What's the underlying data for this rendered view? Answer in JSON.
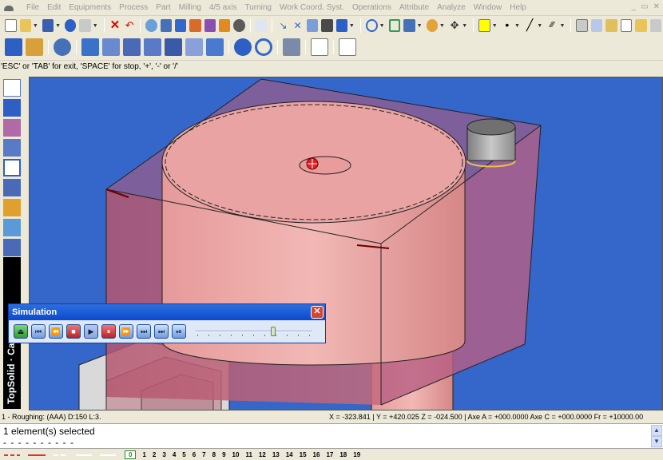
{
  "menu": {
    "items": [
      "File",
      "Edit",
      "Equipments",
      "Process",
      "Part",
      "Milling",
      "4/5 axis",
      "Turning",
      "Work Coord. Syst.",
      "Operations",
      "Attribute",
      "Analyze",
      "Window",
      "Help"
    ]
  },
  "prompt": "'ESC' or 'TAB' for exit, 'SPACE' for stop, '+', '-' or '/'",
  "simulation": {
    "title": "Simulation",
    "slider_fraction": 0.66
  },
  "brand": {
    "text": "TopSolid · Ca"
  },
  "status": {
    "left": "1 - Roughing:   (AAA) D:150  L:3.",
    "right": "X = -323.841  | Y = +420.025  Z = -024.500  | Axe A = +000.0000  Axe C = +000.0000  Fr = +10000.00"
  },
  "messages": {
    "line1": "1 element(s) selected",
    "line2": "- - - - - - - - - -"
  },
  "layers": {
    "active": "0",
    "numbers": [
      "1",
      "2",
      "3",
      "4",
      "5",
      "6",
      "7",
      "8",
      "9",
      "10",
      "11",
      "12",
      "13",
      "14",
      "15",
      "16",
      "17",
      "18",
      "19"
    ]
  },
  "colors": {
    "viewport_bg": "#3566c9",
    "part": "#e8a3a3",
    "stock": "#c25a72",
    "tool": "#9a9a9a"
  }
}
